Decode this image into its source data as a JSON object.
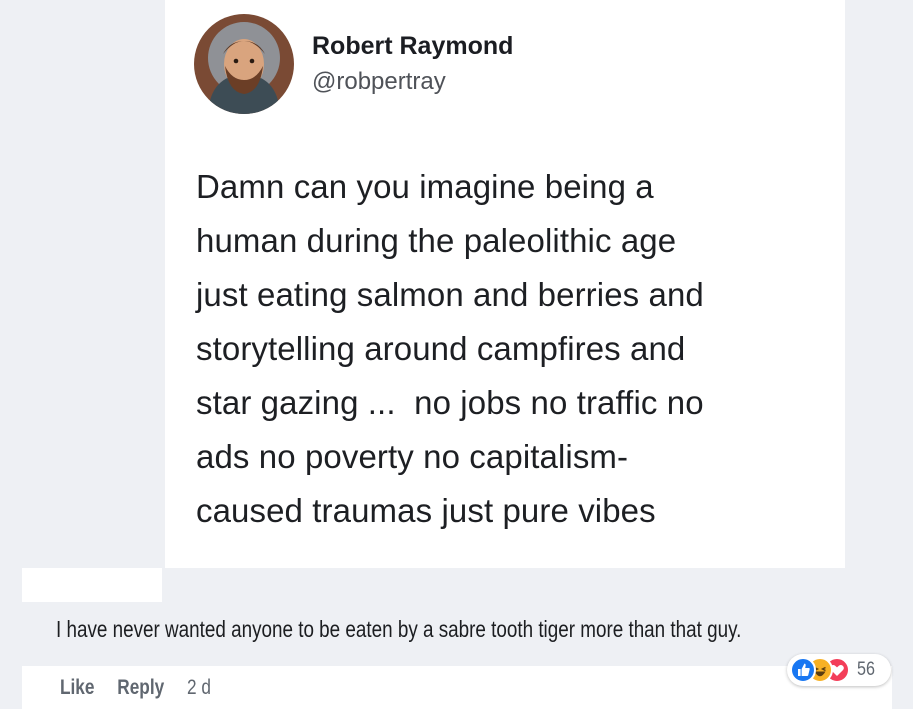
{
  "tweet": {
    "author_name": "Robert Raymond",
    "handle": "@robpertray",
    "text_lines": [
      "Damn can you imagine being a",
      "human during the paleolithic age",
      "just eating salmon and berries and",
      "storytelling around campfires and",
      "star gazing ...  no jobs no traffic no",
      "ads no poverty no capitalism-",
      "caused traumas just pure vibes"
    ]
  },
  "comment": {
    "text": "I have never wanted anyone to be eaten by a sabre tooth tiger more than that guy.",
    "actions": {
      "like": "Like",
      "reply": "Reply",
      "time": "2 d"
    },
    "reactions": {
      "icons": [
        "like-icon",
        "haha-icon",
        "love-icon"
      ],
      "count": "56"
    }
  },
  "colors": {
    "like": "#1877f2",
    "haha": "#f7b125",
    "love": "#f33e58",
    "page_bg": "#eef0f4"
  }
}
